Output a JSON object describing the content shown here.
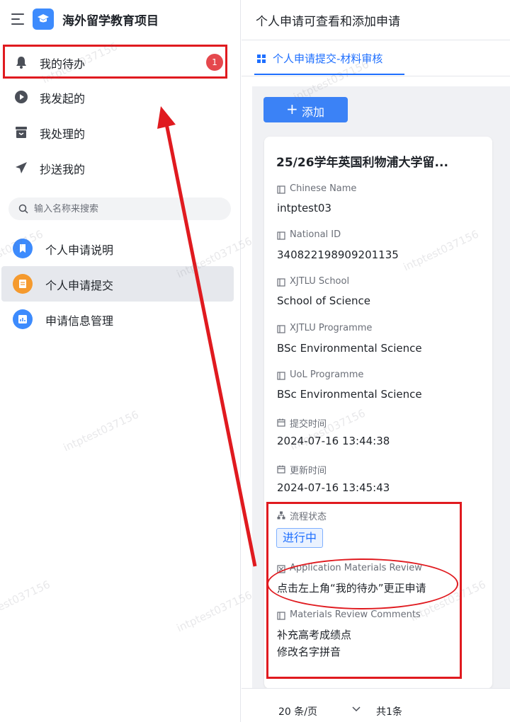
{
  "sidebar": {
    "app_title": "海外留学教育项目",
    "nav": [
      {
        "label": "我的待办",
        "icon": "bell-icon",
        "badge": "1"
      },
      {
        "label": "我发起的",
        "icon": "play-circle-icon"
      },
      {
        "label": "我处理的",
        "icon": "inbox-icon"
      },
      {
        "label": "抄送我的",
        "icon": "send-icon"
      }
    ],
    "search_placeholder": "输入名称来搜索",
    "apps": [
      {
        "label": "个人申请说明",
        "icon": "bookmark-icon",
        "color": "#3d8bfd"
      },
      {
        "label": "个人申请提交",
        "icon": "document-icon",
        "color": "#f59a2e",
        "active": true
      },
      {
        "label": "申请信息管理",
        "icon": "chart-icon",
        "color": "#3d8bfd"
      }
    ]
  },
  "main": {
    "title": "个人申请可查看和添加申请",
    "tab": "个人申请提交-材料审核",
    "add_button": "添加",
    "card": {
      "title": "25/26学年英国利物浦大学留...",
      "fields": [
        {
          "label": "Chinese Name",
          "value": "intptest03"
        },
        {
          "label": "National ID",
          "value": "340822198909201135"
        },
        {
          "label": "XJTLU School",
          "value": "School of Science"
        },
        {
          "label": "XJTLU Programme",
          "value": "BSc Environmental Science"
        },
        {
          "label": "UoL Programme",
          "value": "BSc Environmental Science"
        },
        {
          "label": "提交时间",
          "value": "2024-07-16 13:44:38"
        },
        {
          "label": "更新时间",
          "value": "2024-07-16 13:45:43"
        }
      ],
      "status_label": "流程状态",
      "status_value": "进行中",
      "review_label": "Application Materials Review",
      "review_value": "点击左上角“我的待办”更正申请",
      "comments_label": "Materials Review Comments",
      "comments": [
        "补充高考成绩点",
        "修改名字拼音"
      ]
    },
    "pager": {
      "page_size": "20 条/页",
      "total": "共1条"
    }
  },
  "watermark": "intptest037156",
  "colors": {
    "accent": "#1e6fff",
    "annotation_red": "#e01a1f",
    "badge_red": "#e5484d"
  }
}
